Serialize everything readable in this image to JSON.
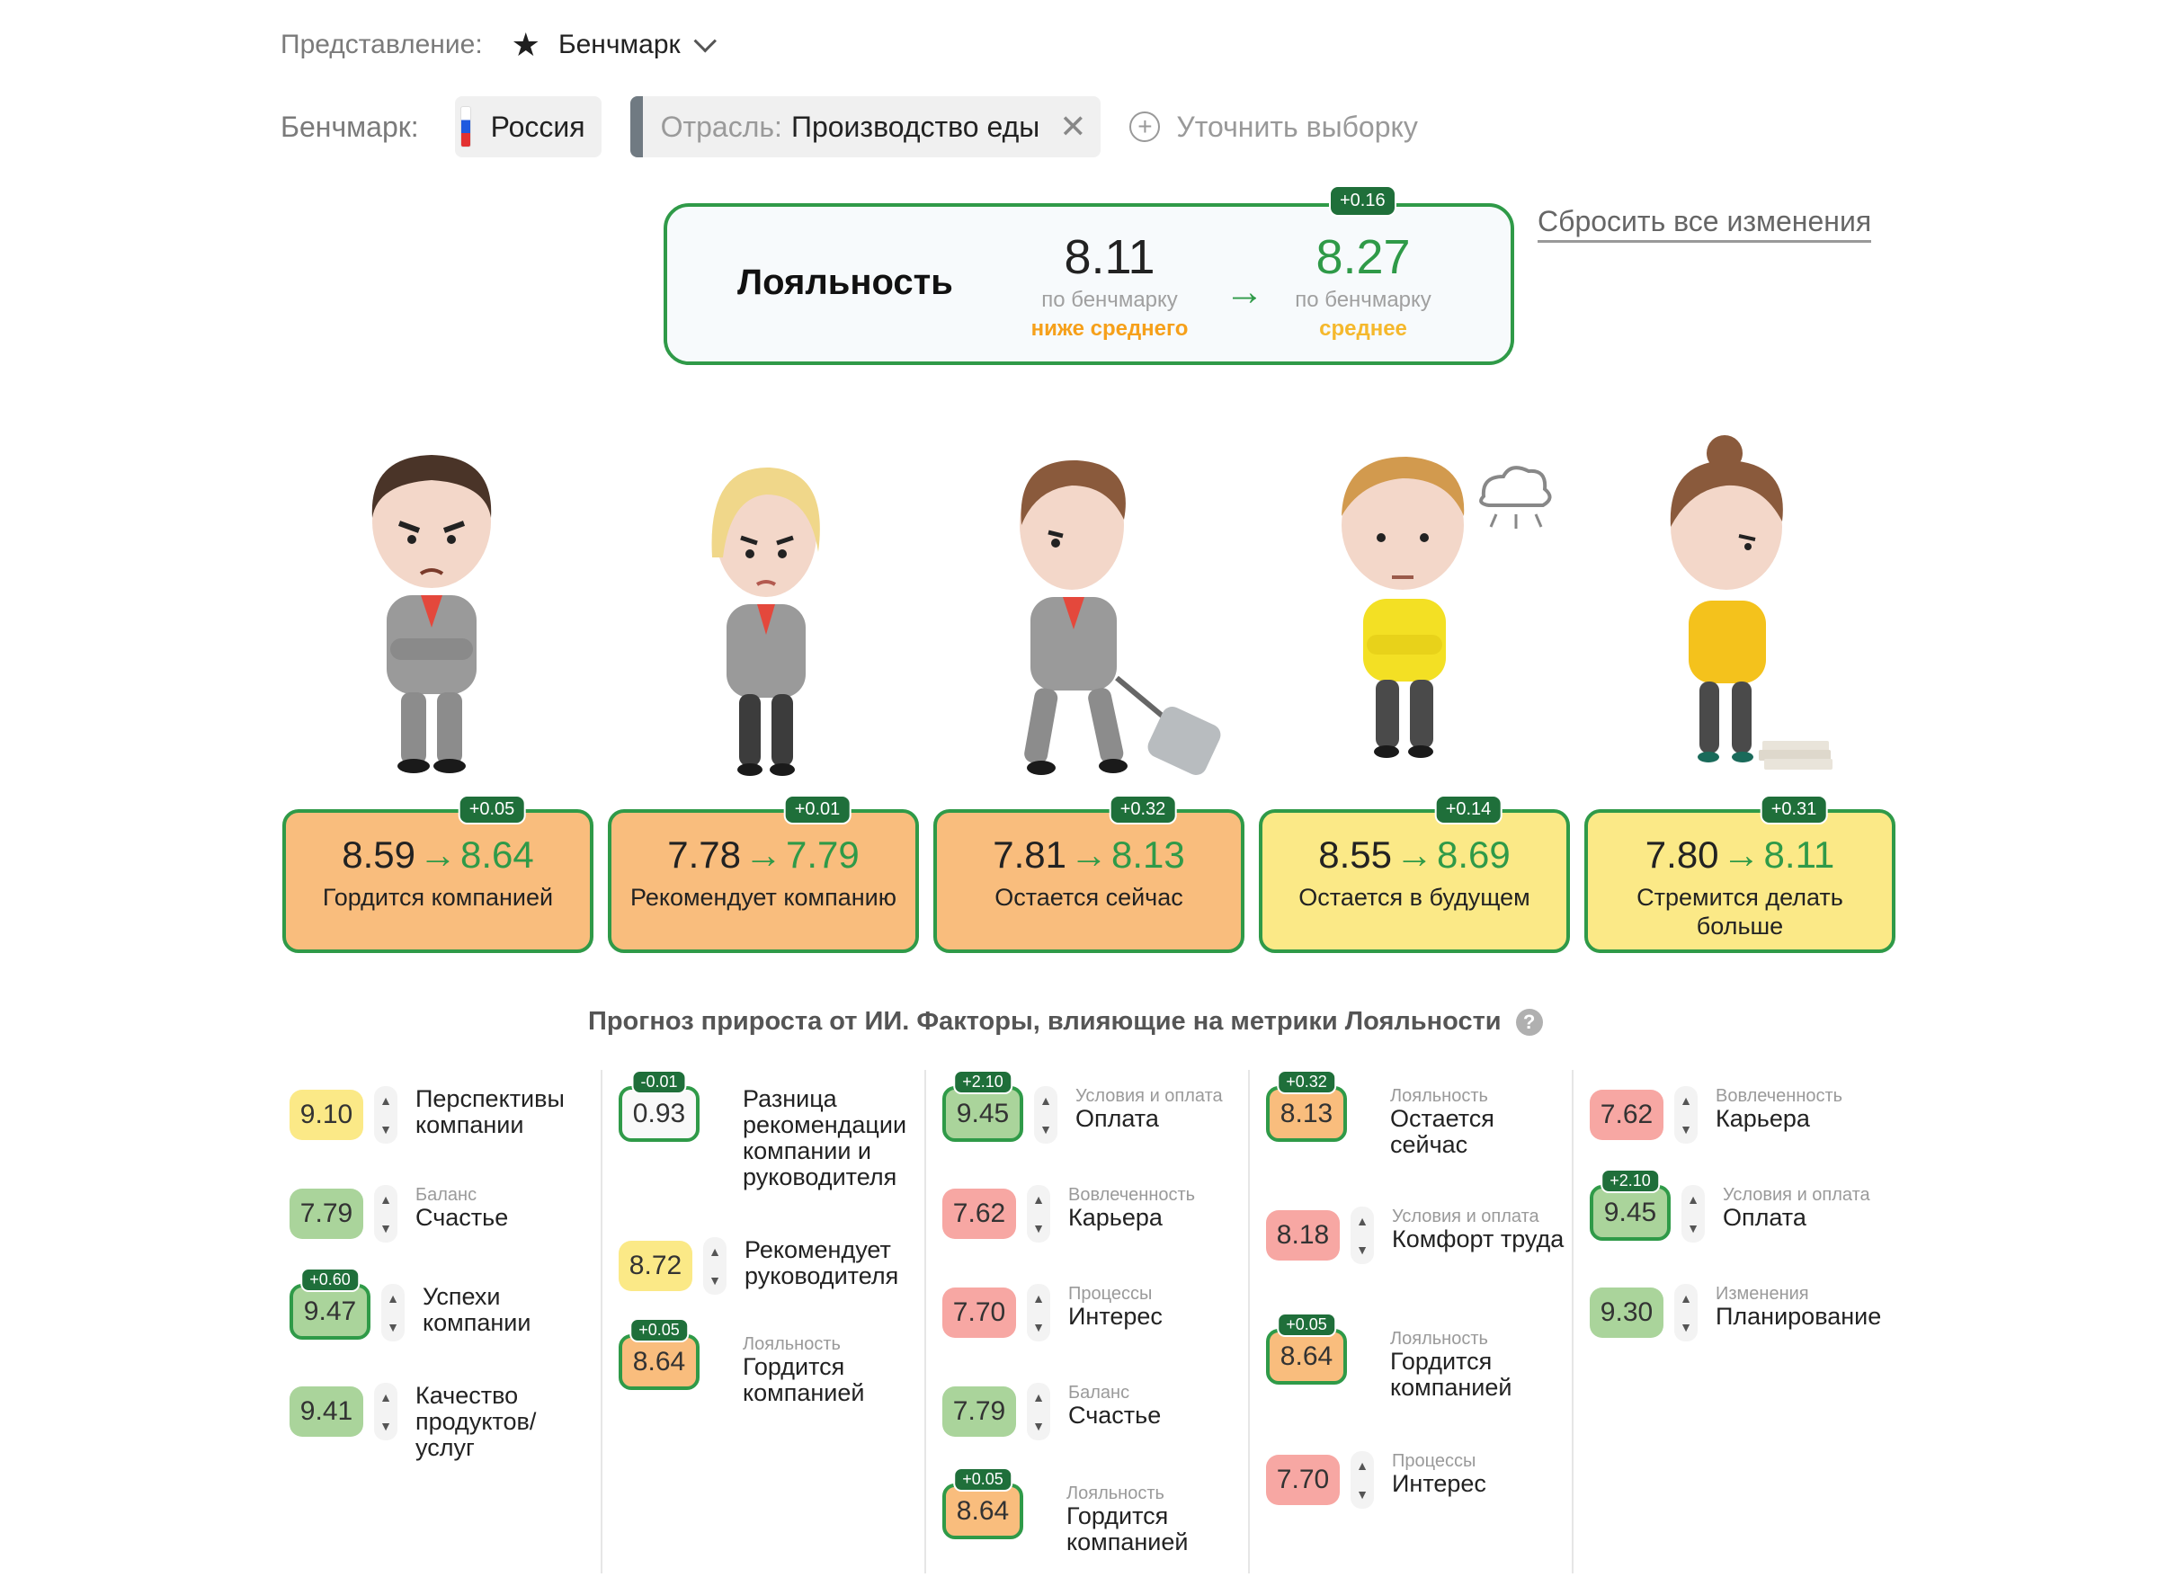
{
  "view": {
    "label": "Представление:",
    "value": "Бенчмарк"
  },
  "benchmark": {
    "label": "Бенчмарк:",
    "country": "Россия",
    "sector_key": "Отрасль:",
    "sector_value": "Производство еды",
    "refine": "Уточнить выборку"
  },
  "loyalty": {
    "title": "Лояльность",
    "from": "8.11",
    "to": "8.27",
    "delta": "+0.16",
    "from_sub": "по бенчмарку",
    "to_sub": "по бенчмарку",
    "from_level": "ниже среднего",
    "to_level": "среднее"
  },
  "reset": "Сбросить все изменения",
  "metrics": [
    {
      "from": "8.59",
      "to": "8.64",
      "delta": "+0.05",
      "name": "Гордится компанией"
    },
    {
      "from": "7.78",
      "to": "7.79",
      "delta": "+0.01",
      "name": "Рекомендует компанию"
    },
    {
      "from": "7.81",
      "to": "8.13",
      "delta": "+0.32",
      "name": "Остается сейчас"
    },
    {
      "from": "8.55",
      "to": "8.69",
      "delta": "+0.14",
      "name": "Остается в будущем"
    },
    {
      "from": "7.80",
      "to": "8.11",
      "delta": "+0.31",
      "name": "Стремится делать больше"
    }
  ],
  "ai_title": "Прогноз прироста от ИИ. Факторы, влияющие на метрики Лояльности",
  "factors": [
    [
      {
        "value": "9.10",
        "delta": "",
        "category": "",
        "name": "Перспективы компании"
      },
      {
        "value": "7.79",
        "delta": "",
        "category": "Баланс",
        "name": "Счастье"
      },
      {
        "value": "9.47",
        "delta": "+0.60",
        "category": "",
        "name": "Успехи компании"
      },
      {
        "value": "9.41",
        "delta": "",
        "category": "",
        "name": "Качество продуктов/ услуг"
      }
    ],
    [
      {
        "value": "0.93",
        "delta": "-0.01",
        "category": "",
        "name": "Разница рекомендации компании и руководителя"
      },
      {
        "value": "8.72",
        "delta": "",
        "category": "",
        "name": "Рекомендует руководителя"
      },
      {
        "value": "8.64",
        "delta": "+0.05",
        "category": "Лояльность",
        "name": "Гордится компанией"
      }
    ],
    [
      {
        "value": "9.45",
        "delta": "+2.10",
        "category": "Условия и оплата",
        "name": "Оплата"
      },
      {
        "value": "7.62",
        "delta": "",
        "category": "Вовлеченность",
        "name": "Карьера"
      },
      {
        "value": "7.70",
        "delta": "",
        "category": "Процессы",
        "name": "Интерес"
      },
      {
        "value": "7.79",
        "delta": "",
        "category": "Баланс",
        "name": "Счастье"
      },
      {
        "value": "8.64",
        "delta": "+0.05",
        "category": "Лояльность",
        "name": "Гордится компанией"
      }
    ],
    [
      {
        "value": "8.13",
        "delta": "+0.32",
        "category": "Лояльность",
        "name": "Остается сейчас"
      },
      {
        "value": "8.18",
        "delta": "",
        "category": "Условия и оплата",
        "name": "Комфорт труда"
      },
      {
        "value": "8.64",
        "delta": "+0.05",
        "category": "Лояльность",
        "name": "Гордится компанией"
      },
      {
        "value": "7.70",
        "delta": "",
        "category": "Процессы",
        "name": "Интерес"
      }
    ],
    [
      {
        "value": "7.62",
        "delta": "",
        "category": "Вовлеченность",
        "name": "Карьера"
      },
      {
        "value": "9.45",
        "delta": "+2.10",
        "category": "Условия и оплата",
        "name": "Оплата"
      },
      {
        "value": "9.30",
        "delta": "",
        "category": "Изменения",
        "name": "Планирование"
      }
    ]
  ],
  "colors": {
    "accent_green": "#2f9a48",
    "badge_dark": "#1f6f3a",
    "orange": "#f9bd7d",
    "yellow": "#fbe987",
    "green": "#aad49b",
    "red": "#f7a7a3",
    "level_orange": "#f6a01a"
  }
}
